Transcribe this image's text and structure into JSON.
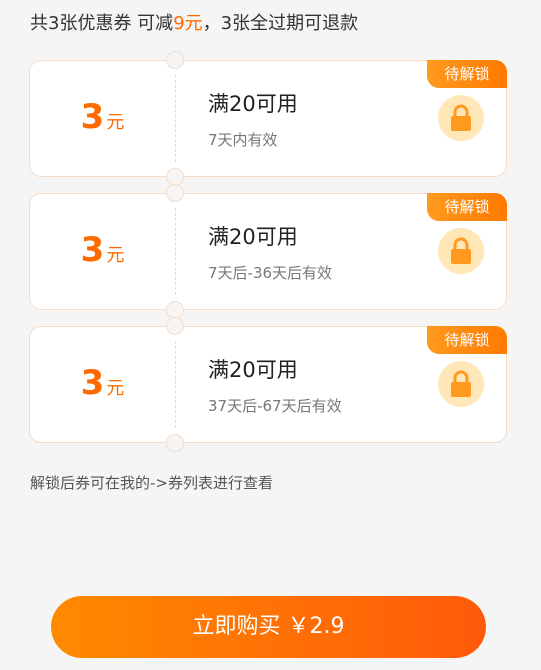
{
  "summary": {
    "part1": "共3张优惠券 可减",
    "amount": "9元",
    "part2": "，3张全过期可退款"
  },
  "coupons": [
    {
      "value": "3",
      "unit": "元",
      "condition": "满20可用",
      "validity": "7天内有效",
      "badge": "待解锁",
      "icon": "lock-icon"
    },
    {
      "value": "3",
      "unit": "元",
      "condition": "满20可用",
      "validity": "7天后-36天后有效",
      "badge": "待解锁",
      "icon": "lock-icon"
    },
    {
      "value": "3",
      "unit": "元",
      "condition": "满20可用",
      "validity": "37天后-67天后有效",
      "badge": "待解锁",
      "icon": "lock-icon"
    }
  ],
  "hint": "解锁后券可在我的->券列表进行查看",
  "buy_button": {
    "label": "立即购买 ￥2.9"
  },
  "colors": {
    "accent": "#ff6a00",
    "badge": "#ff8a00",
    "lock_bg": "#ffe7b8",
    "lock": "#ff9a1f"
  }
}
